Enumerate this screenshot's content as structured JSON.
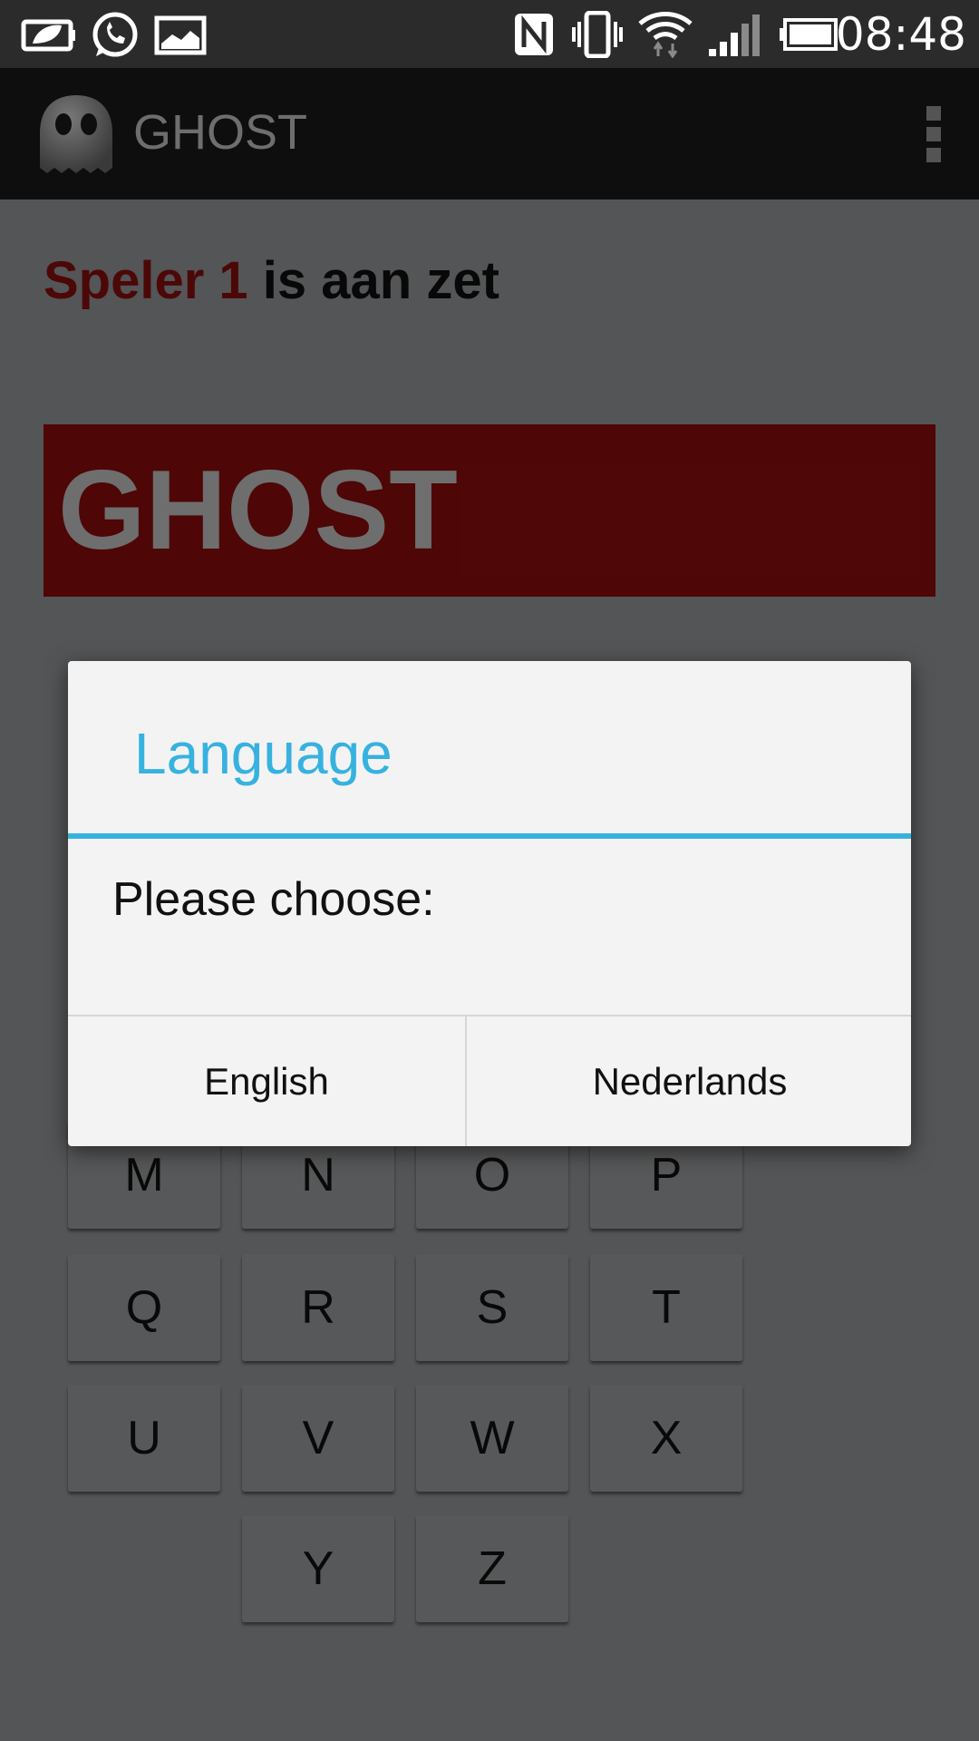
{
  "status_bar": {
    "time": "08:48",
    "icons": [
      "battery-saver-icon",
      "whatsapp-icon",
      "gallery-icon",
      "nfc-icon",
      "vibrate-icon",
      "wifi-icon",
      "signal-icon",
      "battery-icon"
    ]
  },
  "action_bar": {
    "title": "GHOST",
    "logo": "ghost-logo-icon",
    "overflow": "overflow-menu-icon"
  },
  "game": {
    "player": "Speler 1",
    "turn_suffix": " is aan zet",
    "word": "GHOST",
    "keys": [
      "M",
      "N",
      "O",
      "P",
      "Q",
      "R",
      "S",
      "T",
      "U",
      "V",
      "W",
      "X",
      "Y",
      "Z"
    ]
  },
  "dialog": {
    "title": "Language",
    "message": "Please choose:",
    "button_english": "English",
    "button_nederlands": "Nederlands"
  },
  "colors": {
    "accent": "#37b2e0",
    "player": "#8a0e0e",
    "word_box": "#8f0c0c"
  }
}
